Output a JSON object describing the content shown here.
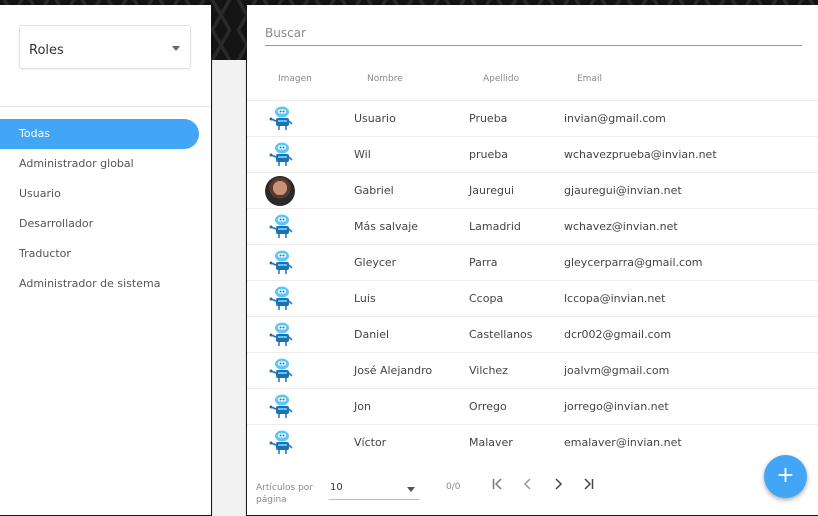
{
  "sidebar": {
    "roles_select": {
      "value": "Roles"
    },
    "items": [
      {
        "label": "Todas",
        "active": true
      },
      {
        "label": "Administrador global",
        "active": false
      },
      {
        "label": "Usuario",
        "active": false
      },
      {
        "label": "Desarrollador",
        "active": false
      },
      {
        "label": "Traductor",
        "active": false
      },
      {
        "label": "Administrador de sistema",
        "active": false
      }
    ]
  },
  "main": {
    "search": {
      "placeholder": "Buscar"
    },
    "columns": [
      "Imagen",
      "Nombre",
      "Apellido",
      "Email"
    ],
    "rows": [
      {
        "avatar": "bot-avatar-icon",
        "nombre": "Usuario",
        "apellido": "Prueba",
        "email": "invian@gmail.com"
      },
      {
        "avatar": "bot-avatar-icon",
        "nombre": "Wil",
        "apellido": "prueba",
        "email": "wchavezprueba@invian.net"
      },
      {
        "avatar": "user-photo",
        "nombre": "Gabriel",
        "apellido": "Jauregui",
        "email": "gjauregui@invian.net"
      },
      {
        "avatar": "bot-avatar-icon",
        "nombre": "Más salvaje",
        "apellido": "Lamadrid",
        "email": "wchavez@invian.net"
      },
      {
        "avatar": "bot-avatar-icon",
        "nombre": "Gleycer",
        "apellido": "Parra",
        "email": "gleycerparra@gmail.com"
      },
      {
        "avatar": "bot-avatar-icon",
        "nombre": "Luis",
        "apellido": "Ccopa",
        "email": "lccopa@invian.net"
      },
      {
        "avatar": "bot-avatar-icon",
        "nombre": "Daniel",
        "apellido": "Castellanos",
        "email": "dcr002@gmail.com"
      },
      {
        "avatar": "bot-avatar-icon",
        "nombre": "José Alejandro",
        "apellido": "Vilchez",
        "email": "joalvm@gmail.com"
      },
      {
        "avatar": "bot-avatar-icon",
        "nombre": "Jon",
        "apellido": "Orrego",
        "email": "jorrego@invian.net"
      },
      {
        "avatar": "bot-avatar-icon",
        "nombre": "Víctor",
        "apellido": "Malaver",
        "email": "emalaver@invian.net"
      }
    ],
    "paginator": {
      "items_per_page_label": "Artículos por página",
      "page_size": "10",
      "range_label": "0/0",
      "first_icon": "first-page-icon",
      "prev_icon": "chevron-left-icon",
      "next_icon": "chevron-right-icon",
      "last_icon": "last-page-icon"
    },
    "fab": {
      "label": "+"
    }
  },
  "colors": {
    "accent": "#42a5f5",
    "bot_dark": "#1f6fb5",
    "bot_light": "#5bc8f5"
  }
}
